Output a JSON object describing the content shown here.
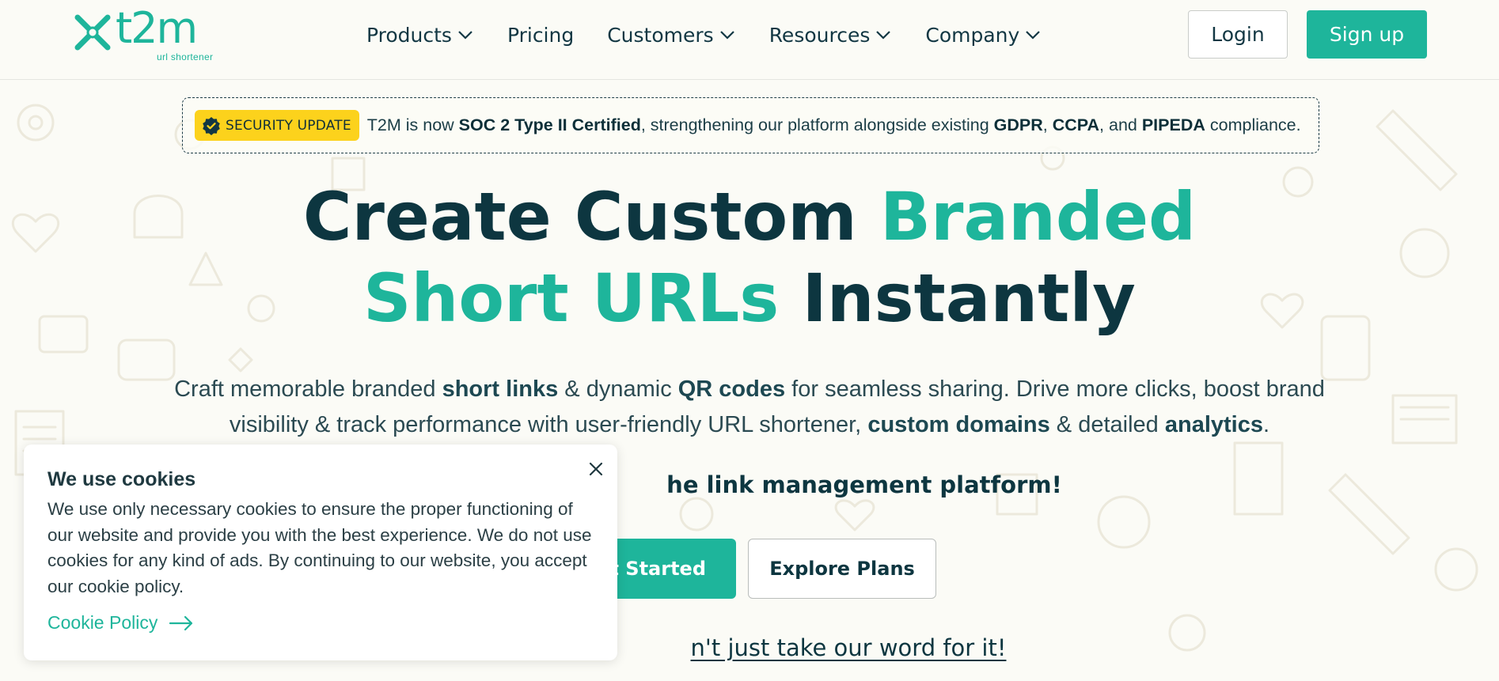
{
  "brand": {
    "logo_text": "t2m",
    "logo_tagline": "url shortener",
    "accent": "#1eb59b",
    "dark": "#0d3640",
    "badge_color": "#fcd21c"
  },
  "nav": {
    "items": [
      {
        "label": "Products",
        "dropdown": true
      },
      {
        "label": "Pricing",
        "dropdown": false
      },
      {
        "label": "Customers",
        "dropdown": true
      },
      {
        "label": "Resources",
        "dropdown": true
      },
      {
        "label": "Company",
        "dropdown": true
      }
    ],
    "login_label": "Login",
    "signup_label": "Sign up"
  },
  "announcement": {
    "badge": "SECURITY UPDATE",
    "text_1": "T2M is now ",
    "bold_1": "SOC 2 Type II Certified",
    "text_2": ", strengthening our platform alongside existing ",
    "bold_2": "GDPR",
    "text_3": ", ",
    "bold_3": "CCPA",
    "text_4": ", and ",
    "bold_4": "PIPEDA",
    "text_5": " compliance."
  },
  "hero": {
    "line1_dark": "Create Custom ",
    "line1_teal": "Branded",
    "line2_teal": "Short URLs",
    "line2_dark": " Instantly",
    "sub1_a": "Craft memorable branded ",
    "sub1_b": "short links",
    "sub1_c": " & dynamic ",
    "sub1_d": "QR codes",
    "sub1_e": " for seamless sharing. Drive more clicks, boost brand",
    "sub2_a": "visibility & track performance with user-friendly URL shortener, ",
    "sub2_b": "custom domains",
    "sub2_c": " & detailed ",
    "sub2_d": "analytics",
    "sub2_e": ".",
    "tagline": "he link management platform!",
    "cta_primary": "et Started",
    "cta_secondary": "Explore Plans",
    "proof_link": "n't just take our word for it!"
  },
  "cookie": {
    "title": "We use cookies",
    "body": "We use only necessary cookies to ensure the proper functioning of our website and provide you with the best experience. We do not use cookies for any kind of ads. By continuing to our website, you accept our cookie policy.",
    "link_label": "Cookie Policy",
    "close_icon": "close-icon",
    "arrow_icon": "arrow-right-icon"
  }
}
